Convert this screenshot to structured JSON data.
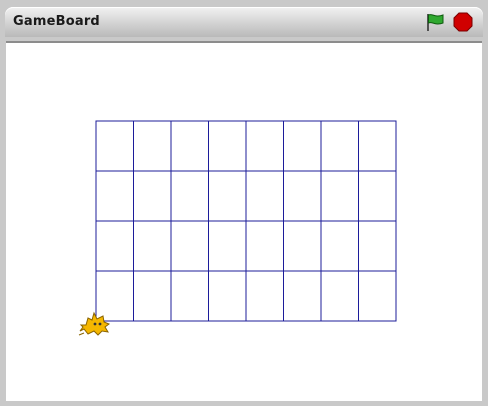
{
  "window": {
    "title": "GameBoard"
  },
  "toolbar": {
    "go_icon": "green-flag-icon",
    "stop_icon": "stop-sign-icon"
  },
  "colors": {
    "grid_line": "#1c1c9a",
    "flag": "#2fa82f",
    "stop": "#d00000",
    "sprite": "#f5b700"
  },
  "board": {
    "rows": 4,
    "columns": 8
  },
  "sprite": {
    "name": "cat-sprite"
  }
}
